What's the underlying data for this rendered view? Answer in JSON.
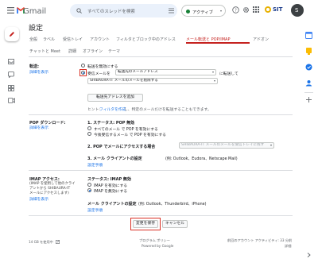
{
  "header": {
    "app_name": "Gmail",
    "search_placeholder": "すべてのスレッドを検索",
    "status": "アクティブ",
    "brand": "SIT",
    "avatar_letter": "S"
  },
  "settings": {
    "title": "設定",
    "tabs_row1": [
      "全般",
      "ラベル",
      "受信トレイ",
      "アカウント",
      "フィルタとブロック中のアドレス",
      "メール転送と POP/IMAP",
      "アドオン"
    ],
    "tabs_row2": [
      "チャットと Meet",
      "詳細",
      "オフライン",
      "テーマ"
    ],
    "active_tab": "メール転送と POP/IMAP"
  },
  "forwarding": {
    "label": "転送:",
    "details_link": "詳細を表示",
    "option_disable": "転送を無効にする",
    "option_forward_prefix": "受信メールを",
    "forward_address_select": "転送先のメールアドレス",
    "forward_suffix": "に転送して",
    "action_select": "SHIBAURA-IT メールのメールを削除する",
    "add_button": "転送先アドレスを追加",
    "hint_prefix": "ヒント:",
    "hint_link": "フィルタを作成",
    "hint_suffix": "し、特定のメールだけを転送することもできます。"
  },
  "pop": {
    "label": "POP ダウンロード:",
    "details_link": "詳細を表示",
    "step1": "1. ステータス: POP 無効",
    "option_all": "すべてのメール で POP を有効にする",
    "option_from_now": "今後受信するメール で POP を有効にする",
    "step2": "2. POP でメールにアクセスする場合",
    "step2_select": "SHIBAURA-IT メールのメールを受信トレイに残す",
    "step3": "3. メール クライアントの設定",
    "step3_examples": "(例: Outlook、Eudora、Netscape Mail)",
    "setup_link": "設定手順"
  },
  "imap": {
    "label": "IMAP アクセス:",
    "desc_lines": [
      "(IMAP を使用して他のクライ",
      "アントから SHIBAURA-IT",
      "メールにアクセスします)"
    ],
    "details_link": "詳細を表示",
    "status": "ステータス: IMAP 無効",
    "option_enable": "IMAP を有効にする",
    "option_disable": "IMAP を無効にする",
    "client_settings": "メール クライアントの設定",
    "client_examples": "(例: Outlook、Thunderbird、iPhone)",
    "setup_link": "設定手順"
  },
  "actions": {
    "save": "変更を保存",
    "cancel": "キャンセル"
  },
  "footer": {
    "storage": "14 GB を使用中",
    "policy": "プログラム ポリシー",
    "powered": "Powered by Google",
    "last_activity": "前回のアカウント アクティビティ: 33 分前",
    "details": "詳細"
  },
  "colors": {
    "accent": "#1a73e8",
    "active_tab": "#c5221f",
    "highlight": "#d93025",
    "gmail_red": "#ea4335"
  }
}
